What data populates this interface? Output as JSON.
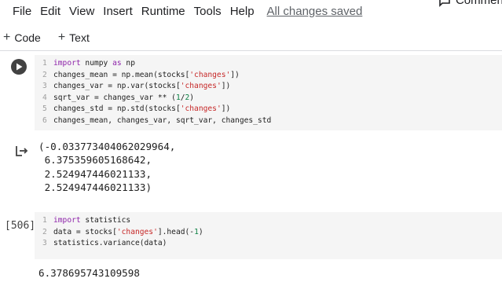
{
  "menu": {
    "items": [
      "File",
      "Edit",
      "View",
      "Insert",
      "Runtime",
      "Tools",
      "Help"
    ],
    "saved_status": "All changes saved",
    "comment_label": "Comment"
  },
  "toolbar": {
    "code_label": "Code",
    "text_label": "Text"
  },
  "cells": [
    {
      "execution_count": "",
      "lines": [
        {
          "n": "1",
          "tokens": [
            {
              "t": "kw",
              "v": "import"
            },
            {
              "t": "txt",
              "v": " numpy "
            },
            {
              "t": "kw",
              "v": "as"
            },
            {
              "t": "txt",
              "v": " np"
            }
          ]
        },
        {
          "n": "2",
          "tokens": [
            {
              "t": "txt",
              "v": "changes_mean = np.mean(stocks["
            },
            {
              "t": "str",
              "v": "'changes'"
            },
            {
              "t": "txt",
              "v": "])"
            }
          ]
        },
        {
          "n": "3",
          "tokens": [
            {
              "t": "txt",
              "v": "changes_var = np.var(stocks["
            },
            {
              "t": "str",
              "v": "'changes'"
            },
            {
              "t": "txt",
              "v": "])"
            }
          ]
        },
        {
          "n": "4",
          "tokens": [
            {
              "t": "txt",
              "v": "sqrt_var = changes_var ** ("
            },
            {
              "t": "num",
              "v": "1"
            },
            {
              "t": "txt",
              "v": "/"
            },
            {
              "t": "num",
              "v": "2"
            },
            {
              "t": "txt",
              "v": ")"
            }
          ]
        },
        {
          "n": "5",
          "tokens": [
            {
              "t": "txt",
              "v": "changes_std = np.std(stocks["
            },
            {
              "t": "str",
              "v": "'changes'"
            },
            {
              "t": "txt",
              "v": "])"
            }
          ]
        },
        {
          "n": "6",
          "tokens": [
            {
              "t": "txt",
              "v": "changes_mean, changes_var, sqrt_var, changes_std"
            }
          ]
        }
      ],
      "output": [
        "(-0.033773404062029964,",
        " 6.375359605168642,",
        " 2.524947446021133,",
        " 2.524947446021133)"
      ]
    },
    {
      "execution_count": "[506]",
      "lines": [
        {
          "n": "1",
          "tokens": [
            {
              "t": "kw",
              "v": "import"
            },
            {
              "t": "txt",
              "v": " statistics"
            }
          ]
        },
        {
          "n": "2",
          "tokens": [
            {
              "t": "txt",
              "v": "data = stocks["
            },
            {
              "t": "str",
              "v": "'changes'"
            },
            {
              "t": "txt",
              "v": "].head(-"
            },
            {
              "t": "num",
              "v": "1"
            },
            {
              "t": "txt",
              "v": ")"
            }
          ]
        },
        {
          "n": "3",
          "tokens": [
            {
              "t": "txt",
              "v": "statistics.variance(data)"
            }
          ]
        }
      ],
      "output": [
        "6.378695743109598"
      ]
    }
  ],
  "colors": {
    "keyword": "#8e24aa",
    "string": "#c62828",
    "number": "#0b8043",
    "cell_background": "#f5f5f5"
  }
}
